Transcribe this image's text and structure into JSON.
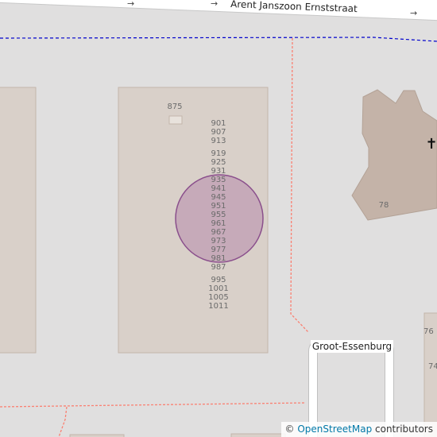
{
  "map": {
    "street_label": "Arent Janszoon Ernststraat",
    "place_label": "Groot-Essenburg",
    "building_number": "875",
    "address_numbers": [
      "901",
      "907",
      "913",
      "919",
      "925",
      "931",
      "935",
      "941",
      "945",
      "951",
      "955",
      "961",
      "967",
      "973",
      "977",
      "981",
      "987",
      "995",
      "1001",
      "1005",
      "1011"
    ],
    "church_number": "78",
    "house_numbers_right": [
      "76",
      "74"
    ],
    "church_symbol": "✝",
    "oneway_symbol": "→",
    "colors": {
      "background": "#e0dfdf",
      "building": "#d9d0c9",
      "building_outline": "#c4b6ab",
      "church": "#c4b3a8",
      "marker_fill": "#c2a3b6",
      "marker_stroke": "#8a4f8c",
      "footway": "#fa8072",
      "boundary": "#0000cc",
      "road": "#ffffff"
    }
  },
  "attribution": {
    "copyright": "©",
    "link_text": "OpenStreetMap",
    "suffix": "contributors"
  }
}
